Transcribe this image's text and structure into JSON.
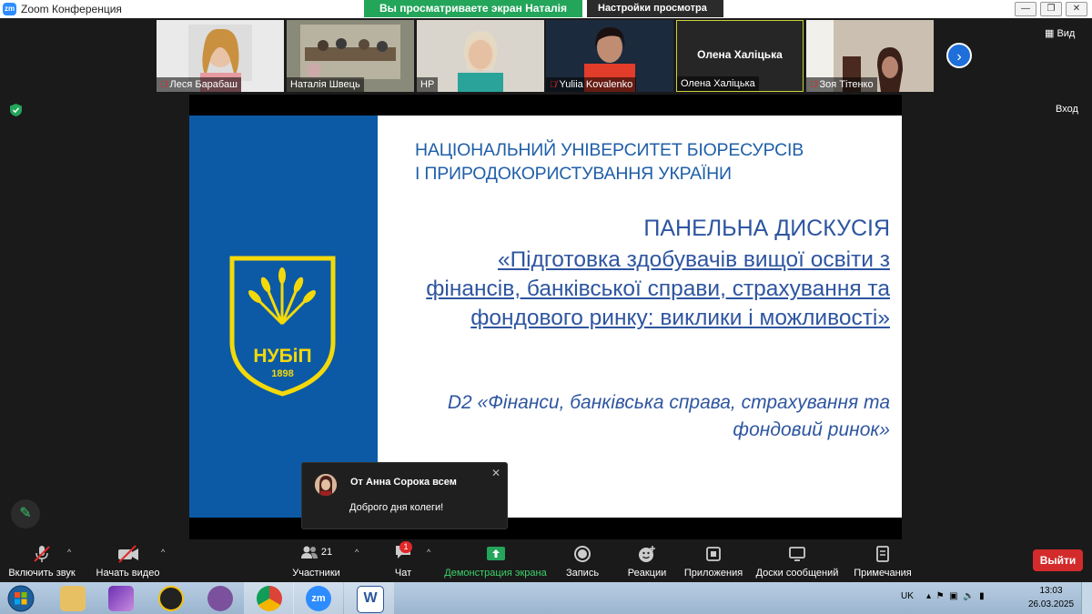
{
  "window": {
    "title": "Zoom Конференция",
    "logo": "zm"
  },
  "banner": {
    "sharing": "Вы просматриваете экран Наталія Швець",
    "view_settings": "Настройки просмотра"
  },
  "window_buttons": {
    "minimize": "—",
    "restore": "❐",
    "close": "✕"
  },
  "participants": [
    {
      "name": "Леся Барабаш",
      "muted": true
    },
    {
      "name": "Наталія Швець",
      "muted": false
    },
    {
      "name": "HP",
      "muted": false
    },
    {
      "name": "Yuliia Kovalenko",
      "muted": true
    },
    {
      "name": "Олена Халіцька",
      "muted": false,
      "display_name": "Олена Халіцька"
    },
    {
      "name": "Зоя Тітенко",
      "muted": true
    }
  ],
  "gallery": {
    "view_label": "Вид",
    "exit_label": "Вход"
  },
  "slide": {
    "university": [
      "НАЦІОНАЛЬНИЙ УНІВЕРСИТЕТ БІОРЕСУРСІВ",
      "І ПРИРОДОКОРИСТУВАННЯ УКРАЇНИ"
    ],
    "title": "ПАНЕЛЬНА ДИСКУСІЯ",
    "topic": "«Підготовка здобувачів вищої освіти з фінансів, банківської справи, страхування та фондового ринку: виклики і можливості»",
    "specialty": "D2 «Фінанси, банківська справа, страхування та фондовий ринок»",
    "logo_text": "НУБіП",
    "logo_year": "1898"
  },
  "chat_popup": {
    "from": "От Анна Сорока всем",
    "message": "Доброго дня колеги!"
  },
  "toolbar": {
    "mute": "Включить звук",
    "video": "Начать видео",
    "participants": "Участники",
    "participants_count": "21",
    "chat": "Чат",
    "chat_badge": "1",
    "share": "Демонстрация экрана",
    "record": "Запись",
    "reactions": "Реакции",
    "apps": "Приложения",
    "whiteboards": "Доски сообщений",
    "notes": "Примечания",
    "leave": "Выйти"
  },
  "taskbar": {
    "lang": "UK",
    "time": "13:03",
    "date": "26.03.2025"
  },
  "colors": {
    "zoom_blue": "#2d8cff",
    "share_green": "#23a55a",
    "leave_red": "#d32b2b",
    "slide_blue": "#0c5aa6",
    "logo_yellow": "#f4d90a"
  }
}
